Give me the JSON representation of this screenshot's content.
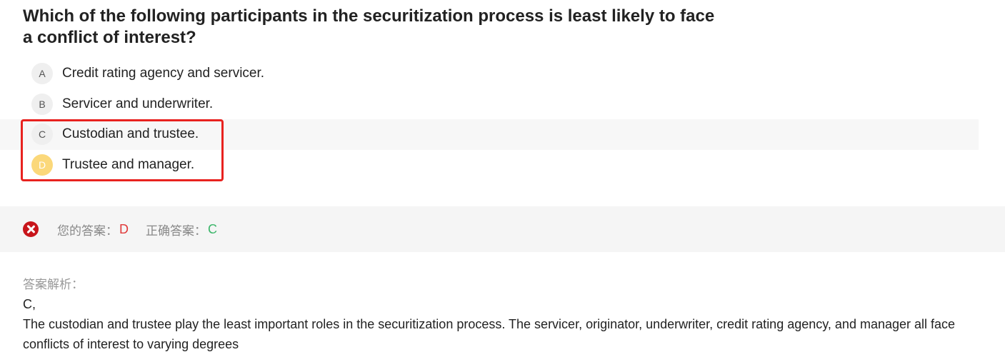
{
  "question": {
    "text": "Which of the following participants in the securitization process is least likely to face a conflict of interest?"
  },
  "options": [
    {
      "letter": "A",
      "text": "Credit rating agency and servicer."
    },
    {
      "letter": "B",
      "text": "Servicer and underwriter."
    },
    {
      "letter": "C",
      "text": "Custodian and trustee."
    },
    {
      "letter": "D",
      "text": "Trustee and manager."
    }
  ],
  "colors": {
    "selected_option_badge": "#fbd87a",
    "wrong_icon": "#c8151b",
    "your_answer": "#e03a3a",
    "correct_answer": "#3cb66a",
    "highlight_box": "#e8221f"
  },
  "result": {
    "icon": "wrong-icon",
    "your_answer_label": "您的答案：",
    "your_answer_value": "D",
    "correct_answer_label": "正确答案：",
    "correct_answer_value": "C"
  },
  "analysis": {
    "title": "答案解析：",
    "answer": "C,",
    "body": "The custodian and trustee play the least important roles in the securitization process. The servicer, originator, underwriter, credit rating agency, and manager all face conflicts of interest to varying degrees"
  }
}
